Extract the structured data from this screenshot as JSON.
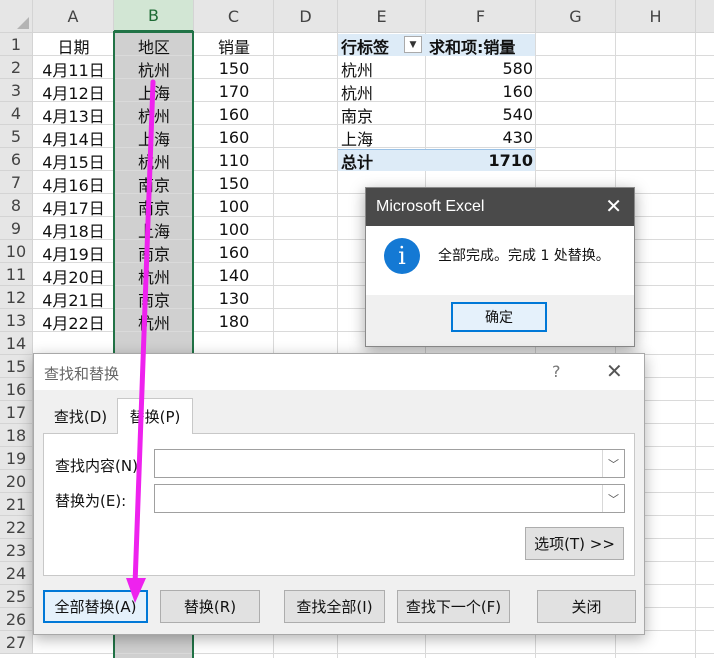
{
  "spreadsheet": {
    "columns": [
      "A",
      "B",
      "C",
      "D",
      "E",
      "F",
      "G",
      "H"
    ],
    "rows": [
      "1",
      "2",
      "3",
      "4",
      "5",
      "6",
      "7",
      "8",
      "9",
      "10",
      "11",
      "12",
      "13",
      "14",
      "15",
      "16",
      "17",
      "18",
      "19",
      "20",
      "21",
      "22",
      "23",
      "24",
      "25",
      "26",
      "27"
    ],
    "headers": {
      "date": "日期",
      "region": "地区",
      "sales": "销量"
    },
    "data": [
      {
        "date": "4月11日",
        "region": "杭州",
        "sales": "150"
      },
      {
        "date": "4月12日",
        "region": "上海",
        "sales": "170"
      },
      {
        "date": "4月13日",
        "region": "杭州",
        "sales": "160"
      },
      {
        "date": "4月14日",
        "region": "上海",
        "sales": "160"
      },
      {
        "date": "4月15日",
        "region": "杭州",
        "sales": "110"
      },
      {
        "date": "4月16日",
        "region": "南京",
        "sales": "150"
      },
      {
        "date": "4月17日",
        "region": "南京",
        "sales": "100"
      },
      {
        "date": "4月18日",
        "region": "上海",
        "sales": "100"
      },
      {
        "date": "4月19日",
        "region": "南京",
        "sales": "160"
      },
      {
        "date": "4月20日",
        "region": "杭州",
        "sales": "140"
      },
      {
        "date": "4月21日",
        "region": "南京",
        "sales": "130"
      },
      {
        "date": "4月22日",
        "region": "杭州",
        "sales": "180"
      }
    ],
    "selected_column": "B"
  },
  "pivot": {
    "row_label_header": "行标签",
    "sum_header": "求和项:销量",
    "rows": [
      {
        "label": "杭州",
        "value": "580"
      },
      {
        "label": "杭州",
        "value": "160"
      },
      {
        "label": "南京",
        "value": "540"
      },
      {
        "label": "上海",
        "value": "430"
      }
    ],
    "total_label": "总计",
    "total_value": "1710"
  },
  "message_box": {
    "title": "Microsoft Excel",
    "close_glyph": "✕",
    "icon_glyph": "i",
    "message": "全部完成。完成 1 处替换。",
    "ok_label": "确定"
  },
  "find_replace": {
    "title": "查找和替换",
    "help_glyph": "?",
    "close_glyph": "✕",
    "tabs": {
      "find": "查找(D)",
      "replace": "替换(P)"
    },
    "active_tab": "replace",
    "find_label": "查找内容(N):",
    "find_value": "",
    "replace_label": "替换为(E):",
    "replace_value": "",
    "options_label": "选项(T) >>",
    "buttons": {
      "replace_all": "全部替换(A)",
      "replace": "替换(R)",
      "find_all": "查找全部(I)",
      "find_next": "查找下一个(F)",
      "close": "关闭"
    }
  },
  "annotation": {
    "arrow_color": "#ee22ee"
  }
}
